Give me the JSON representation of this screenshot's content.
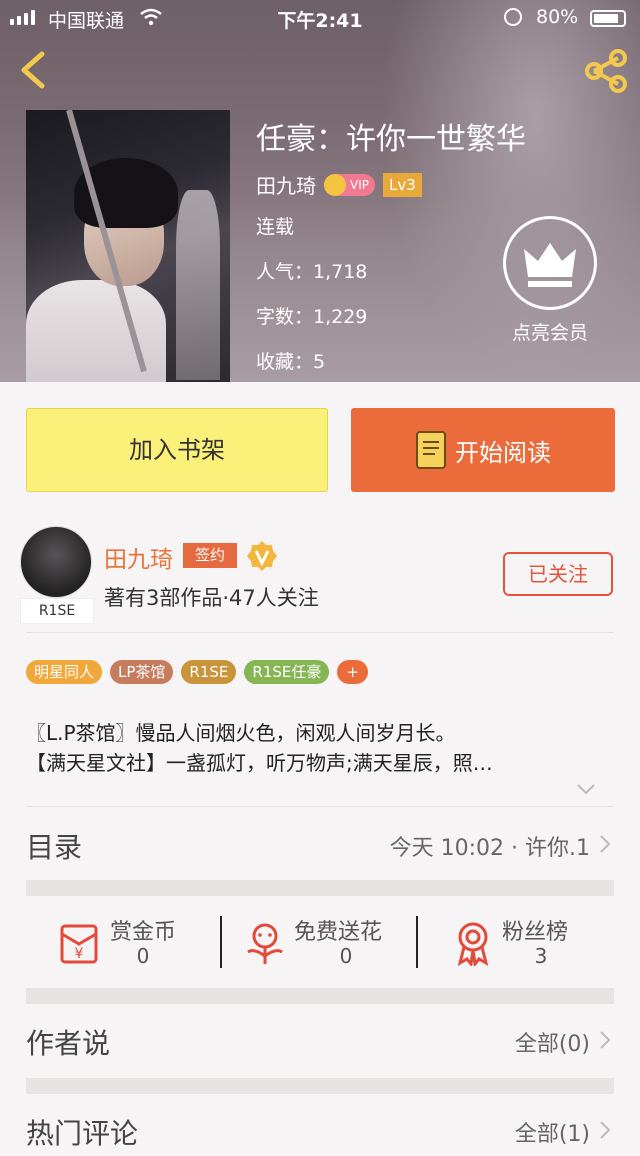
{
  "status_bar": {
    "carrier": "中国联通",
    "time": "下午2:41",
    "battery": "80%"
  },
  "book": {
    "title": "任豪：许你一世繁华",
    "author": "田九琦",
    "vip_label": "VIP",
    "level": "Lv3",
    "status": "连载",
    "popularity": "人气：1,718",
    "word_count": "字数：1,229",
    "favorites": "收藏：5"
  },
  "member": {
    "label": "点亮会员"
  },
  "actions": {
    "add_shelf": "加入书架",
    "start_read": "开始阅读"
  },
  "author_info": {
    "avatar_tag": "R1SE",
    "name": "田九琦",
    "sign_badge": "签约",
    "stats": "著有3部作品·47人关注",
    "follow_label": "已关注"
  },
  "tags": [
    {
      "label": "明星同人",
      "color": "#f2a73b"
    },
    {
      "label": "LP茶馆",
      "color": "#c77d5d"
    },
    {
      "label": "R1SE",
      "color": "#c9943a"
    },
    {
      "label": "R1SE任豪",
      "color": "#86b554"
    },
    {
      "label": "+",
      "color": "#ec6b3a"
    }
  ],
  "description": [
    "〖L.P茶馆〗慢品人间烟火色，闲观人间岁月长。",
    "【满天星文社】一盏孤灯，听万物声;满天星辰，照…"
  ],
  "toc": {
    "title": "目录",
    "latest": "今天 10:02 · 许你.1"
  },
  "stats": [
    {
      "label": "赏金币",
      "value": "0",
      "icon": "reward-coin-icon"
    },
    {
      "label": "免费送花",
      "value": "0",
      "icon": "flower-icon"
    },
    {
      "label": "粉丝榜",
      "value": "3",
      "icon": "medal-icon"
    }
  ],
  "author_says": {
    "title": "作者说",
    "right": "全部(0)"
  },
  "hot_comments": {
    "title": "热门评论",
    "right": "全部(1)"
  },
  "colors": {
    "accent": "#eb6b3a",
    "shelf_button": "#fbf07a",
    "author_name": "#e8743c"
  }
}
